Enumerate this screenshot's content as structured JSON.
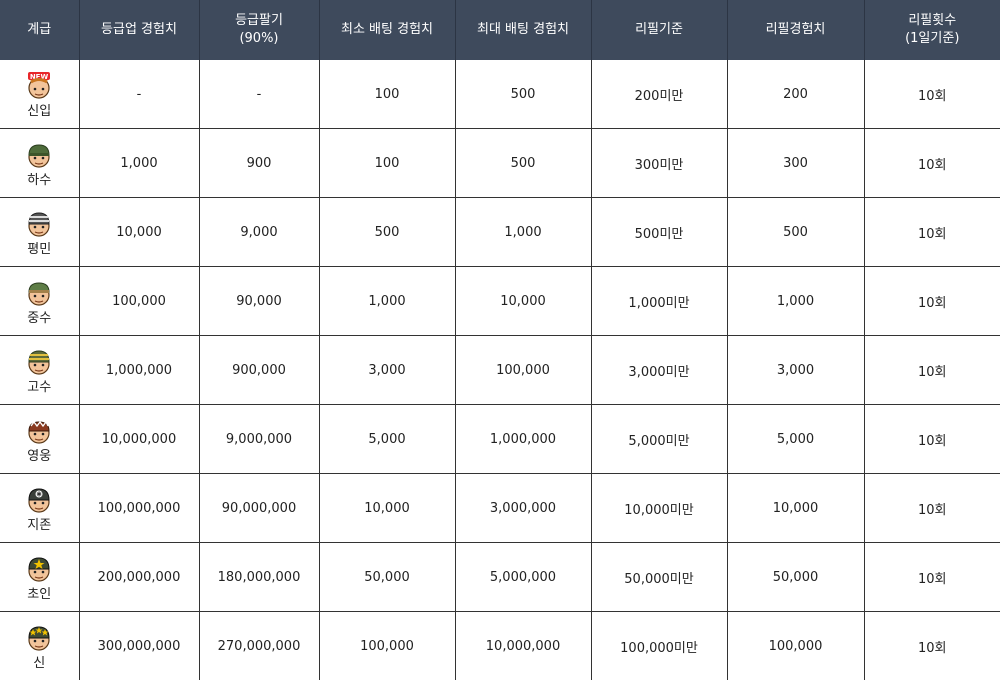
{
  "header": [
    {
      "label": "계급"
    },
    {
      "label": "등급업 경험치"
    },
    {
      "label": "등급팔기\n(90%)"
    },
    {
      "label": "최소 배팅 경험치"
    },
    {
      "label": "최대 배팅 경험치"
    },
    {
      "label": "리필기준"
    },
    {
      "label": "리필경험치"
    },
    {
      "label": "리필횟수\n(1일기준)"
    }
  ],
  "rows": [
    {
      "rank": "신입",
      "icon": "new-face-icon",
      "levelup": "-",
      "sell": "-",
      "min_bet": "100",
      "max_bet": "500",
      "refill_cond": "200미만",
      "refill_exp": "200",
      "refill_count": "10회"
    },
    {
      "rank": "하수",
      "icon": "green-helmet-face-icon",
      "levelup": "1,000",
      "sell": "900",
      "min_bet": "100",
      "max_bet": "500",
      "refill_cond": "300미만",
      "refill_exp": "300",
      "refill_count": "10회"
    },
    {
      "rank": "평민",
      "icon": "striped-cap-face-icon",
      "levelup": "10,000",
      "sell": "9,000",
      "min_bet": "500",
      "max_bet": "1,000",
      "refill_cond": "500미만",
      "refill_exp": "500",
      "refill_count": "10회"
    },
    {
      "rank": "중수",
      "icon": "green-cap-face-icon",
      "levelup": "100,000",
      "sell": "90,000",
      "min_bet": "1,000",
      "max_bet": "10,000",
      "refill_cond": "1,000미만",
      "refill_exp": "1,000",
      "refill_count": "10회"
    },
    {
      "rank": "고수",
      "icon": "yellow-stripe-cap-face-icon",
      "levelup": "1,000,000",
      "sell": "900,000",
      "min_bet": "3,000",
      "max_bet": "100,000",
      "refill_cond": "3,000미만",
      "refill_exp": "3,000",
      "refill_count": "10회"
    },
    {
      "rank": "영웅",
      "icon": "spiked-helmet-face-icon",
      "levelup": "10,000,000",
      "sell": "9,000,000",
      "min_bet": "5,000",
      "max_bet": "1,000,000",
      "refill_cond": "5,000미만",
      "refill_exp": "5,000",
      "refill_count": "10회"
    },
    {
      "rank": "지존",
      "icon": "star-badge-helmet-face-icon",
      "levelup": "100,000,000",
      "sell": "90,000,000",
      "min_bet": "10,000",
      "max_bet": "3,000,000",
      "refill_cond": "10,000미만",
      "refill_exp": "10,000",
      "refill_count": "10회"
    },
    {
      "rank": "초인",
      "icon": "gold-star-helmet-face-icon",
      "levelup": "200,000,000",
      "sell": "180,000,000",
      "min_bet": "50,000",
      "max_bet": "5,000,000",
      "refill_cond": "50,000미만",
      "refill_exp": "50,000",
      "refill_count": "10회"
    },
    {
      "rank": "신",
      "icon": "three-star-helmet-face-icon",
      "levelup": "300,000,000",
      "sell": "270,000,000",
      "min_bet": "100,000",
      "max_bet": "10,000,000",
      "refill_cond": "100,000미만",
      "refill_exp": "100,000",
      "refill_count": "10회"
    }
  ],
  "colors": {
    "header_bg": "#3e4a5c",
    "header_text": "#ffffff",
    "grid_line": "#333333",
    "skin": "#f2c49a",
    "helmet_green": "#4d6b3a"
  },
  "icon_badges": {
    "new": "NEW"
  }
}
